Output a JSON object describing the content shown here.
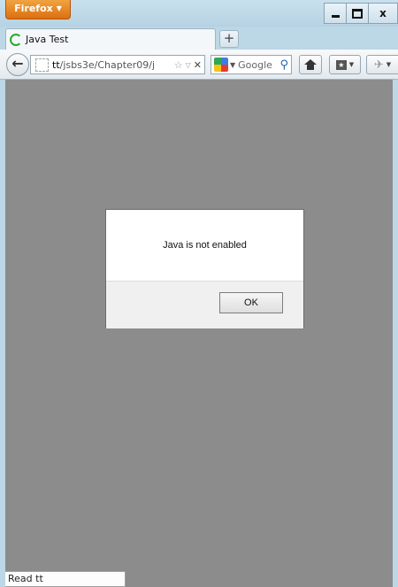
{
  "window": {
    "app_button_label": "Firefox",
    "controls": {
      "minimize": "minimize",
      "maximize": "maximize",
      "close": "x"
    }
  },
  "tabs": [
    {
      "label": "Java Test",
      "loading": true
    }
  ],
  "new_tab_label": "+",
  "navbar": {
    "back_label": "←",
    "url_bold": "tt",
    "url_rest": "/jsbs3e/Chapter09/j",
    "search_engine": "Google",
    "search_button": "⌕",
    "icons": [
      "back-arrow-icon",
      "site-identity-icon",
      "bookmark-star-icon",
      "dropdown-icon",
      "stop-icon",
      "google-icon",
      "search-icon",
      "home-icon",
      "bookmarks-icon",
      "addon-icon"
    ]
  },
  "dialog": {
    "message": "Java is not enabled",
    "ok_label": "OK"
  },
  "status": {
    "text": "Read tt"
  },
  "colors": {
    "firefox_button": "#e57e1f",
    "chrome": "#bcd7e6",
    "content_bg": "#8c8c8c",
    "dialog_bg": "#ffffff"
  }
}
